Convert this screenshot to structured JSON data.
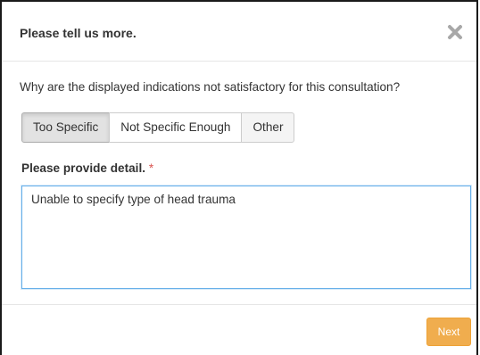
{
  "dialog": {
    "title": "Please tell us more.",
    "close_icon": "close-x-icon"
  },
  "question": {
    "text": "Why are the displayed indications not satisfactory for this consultation?",
    "options": [
      {
        "label": "Too Specific",
        "selected": true
      },
      {
        "label": "Not Specific Enough",
        "selected": false
      },
      {
        "label": "Other",
        "selected": false
      }
    ]
  },
  "detail": {
    "label": "Please provide detail.",
    "required_marker": "*",
    "value": "Unable to specify type of head trauma"
  },
  "footer": {
    "next_label": "Next"
  },
  "colors": {
    "accent": "#f0ad4e",
    "required": "#d9534f",
    "focus_border": "#66afe9"
  }
}
